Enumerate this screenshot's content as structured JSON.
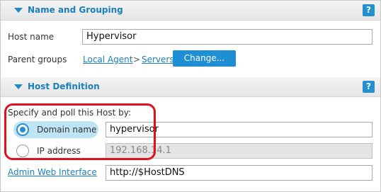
{
  "name_grouping": {
    "title": "Name and Grouping",
    "help": "?",
    "host_name_label": "Host name",
    "host_name_value": "Hypervisor",
    "parent_groups_label": "Parent groups",
    "parent_path": [
      "Local Agent",
      "Servers"
    ],
    "separator": ">",
    "change_button": "Change..."
  },
  "host_definition": {
    "title": "Host Definition",
    "help": "?",
    "specify_label": "Specify and poll this Host by:",
    "options": [
      {
        "label": "Domain name",
        "value": "hypervisor",
        "selected": true
      },
      {
        "label": "IP address",
        "value": "192.168.14.1",
        "selected": false
      }
    ],
    "admin_link": "Admin Web Interface",
    "admin_value": "http://$HostDNS"
  },
  "colors": {
    "accent": "#1a7fbf",
    "button": "#1e8fd4",
    "highlight": "#e0101f",
    "selected_pill": "#bfe4f5"
  }
}
